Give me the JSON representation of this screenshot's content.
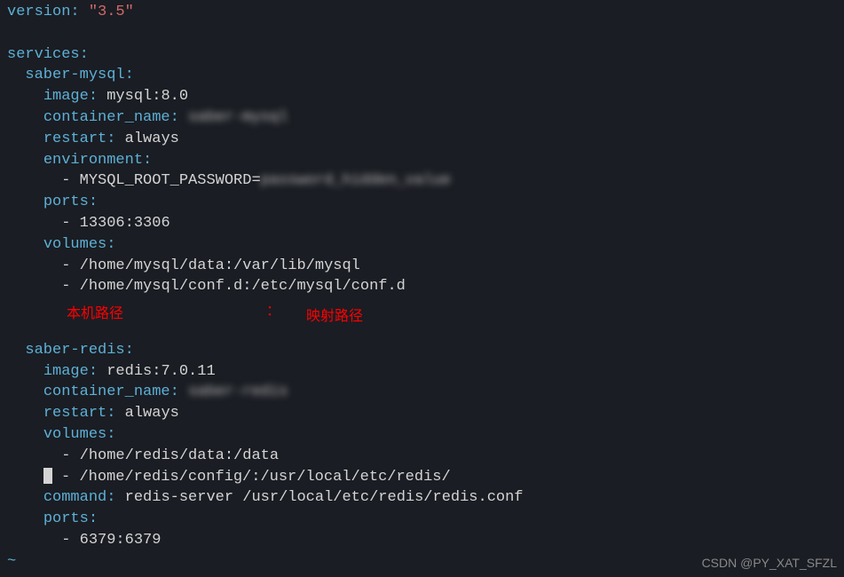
{
  "yaml": {
    "version_key": "version",
    "version_value": "\"3.5\"",
    "services_key": "services",
    "mysql": {
      "service_name": "saber-mysql",
      "image_key": "image",
      "image_value": "mysql:8.0",
      "container_name_key": "container_name",
      "container_name_value": "saber-mysql",
      "restart_key": "restart",
      "restart_value": "always",
      "environment_key": "environment",
      "env_var": "MYSQL_ROOT_PASSWORD=",
      "env_var_blur": "password_hidden_value",
      "ports_key": "ports",
      "port_value": "13306:3306",
      "volumes_key": "volumes",
      "volume1": "/home/mysql/data:/var/lib/mysql",
      "volume2": "/home/mysql/conf.d:/etc/mysql/conf.d"
    },
    "redis": {
      "service_name": "saber-redis",
      "image_key": "image",
      "image_value": "redis:7.0.11",
      "container_name_key": "container_name",
      "container_name_value": "saber-redis",
      "restart_key": "restart",
      "restart_value": "always",
      "volumes_key": "volumes",
      "volume1": "/home/redis/data:/data",
      "volume2": "/home/redis/config/:/usr/local/etc/redis/",
      "command_key": "command",
      "command_value": "redis-server /usr/local/etc/redis/redis.conf",
      "ports_key": "ports",
      "port_value": "6379:6379"
    }
  },
  "annotations": {
    "local_path": "本机路径",
    "colon": "：",
    "mapped_path": "映射路径"
  },
  "watermark": "CSDN @PY_XAT_SFZL",
  "tilde": "~"
}
